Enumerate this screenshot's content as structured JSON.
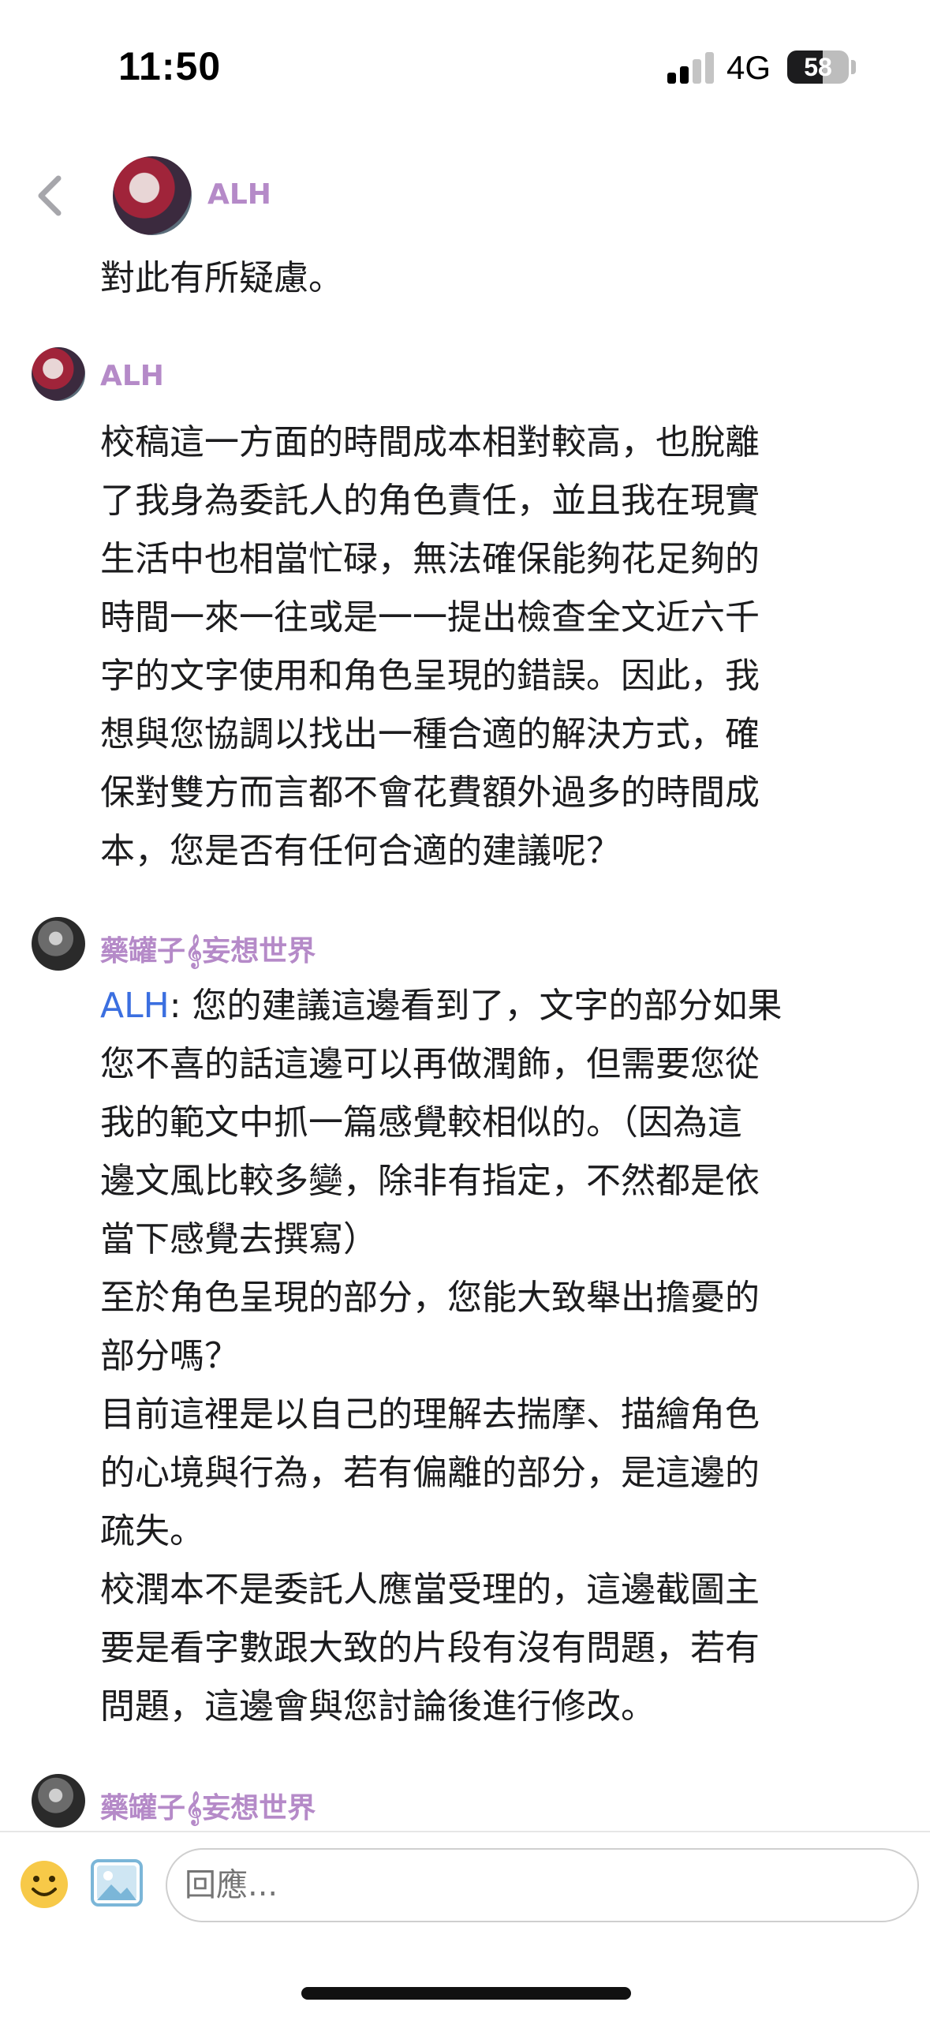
{
  "status_bar": {
    "time": "11:50",
    "network": "4G",
    "battery": "58",
    "battery_level": 0.58
  },
  "header": {
    "user_name": "ALH"
  },
  "messages": [
    {
      "author": "ALH",
      "paragraphs": [
        "對此有所疑慮。"
      ]
    },
    {
      "author": "ALH",
      "paragraphs": [
        "校稿這一方面的時間成本相對較高，也脫離",
        "了我身為委託人的角色責任，並且我在現實",
        "生活中也相當忙碌，無法確保能夠花足夠的",
        "時間一來一往或是一一提出檢查全文近六千",
        "字的文字使用和角色呈現的錯誤。因此，我",
        "想與您協調以找出一種合適的解決方式，確",
        "保對雙方而言都不會花費額外過多的時間成",
        "本，您是否有任何合適的建議呢？"
      ]
    },
    {
      "author": "藥罐子𝄞妄想世界",
      "mention": "ALH",
      "lines": [
        ": 您的建議這邊看到了，文字的部分如果",
        "您不喜的話這邊可以再做潤飾，但需要您從",
        "我的範文中抓一篇感覺較相似的。（因為這",
        "邊文風比較多變，除非有指定，不然都是依",
        "當下感覺去撰寫）",
        "至於角色呈現的部分，您能大致舉出擔憂的",
        "部分嗎？",
        "目前這裡是以自己的理解去揣摩、描繪角色",
        "的心境與行為，若有偏離的部分，是這邊的",
        "疏失。",
        "校潤本不是委託人應當受理的，這邊截圖主",
        "要是看字數跟大致的片段有沒有問題，若有",
        "問題，這邊會與您討論後進行修改。"
      ]
    },
    {
      "author": "藥罐子𝄞妄想世界"
    }
  ],
  "composer": {
    "placeholder": "回應...",
    "emoji_icon": "smiley-icon",
    "image_icon": "image-icon"
  },
  "colors": {
    "author_name": "#b58ac8",
    "mention": "#3b6fe0",
    "emoji_yellow": "#f7c948",
    "image_blue": "#7bb6d8"
  }
}
